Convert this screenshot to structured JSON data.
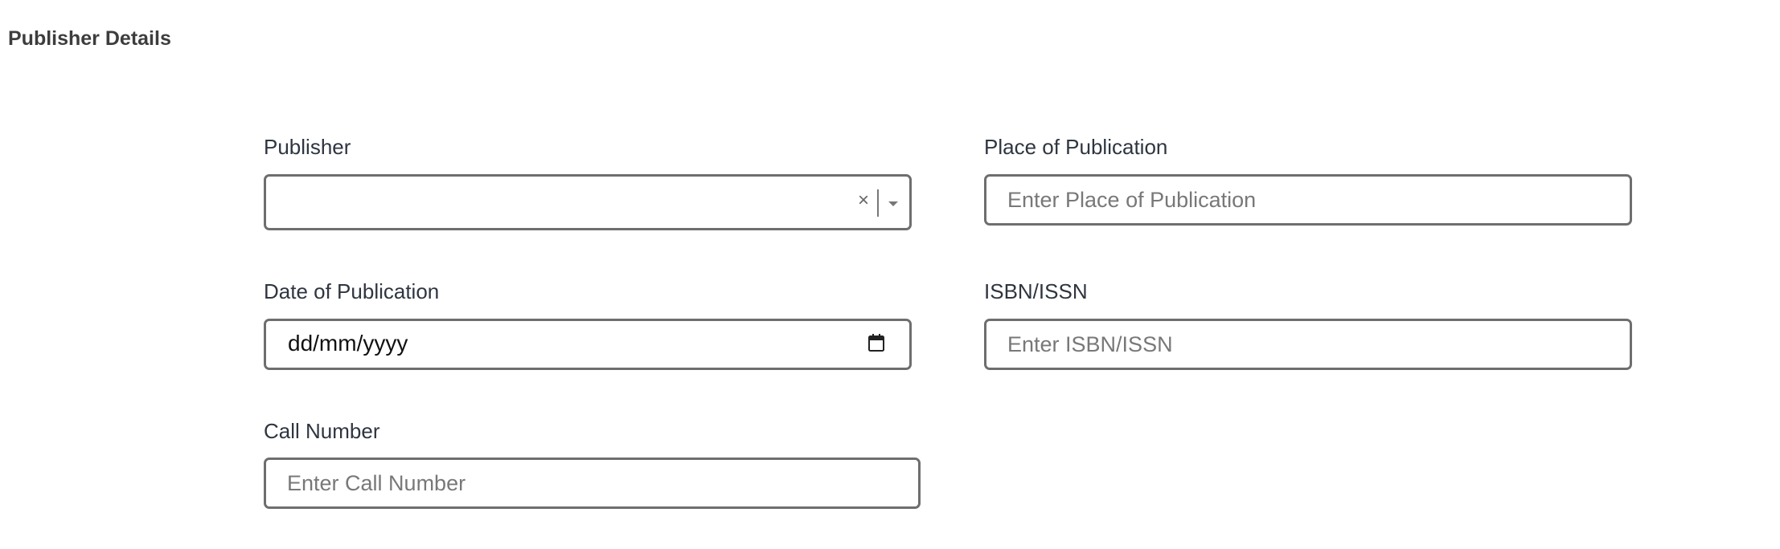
{
  "section": {
    "title": "Publisher Details"
  },
  "fields": {
    "publisher": {
      "label": "Publisher",
      "value": "",
      "clear_glyph": "×"
    },
    "place_of_publication": {
      "label": "Place of Publication",
      "placeholder": "Enter Place of Publication",
      "value": ""
    },
    "date_of_publication": {
      "label": "Date of Publication",
      "display": "dd/mm/yyyy",
      "icon": "calendar-icon"
    },
    "isbn_issn": {
      "label": "ISBN/ISSN",
      "placeholder": "Enter ISBN/ISSN",
      "value": ""
    },
    "call_number": {
      "label": "Call Number",
      "placeholder": "Enter Call Number",
      "value": ""
    }
  },
  "colors": {
    "border": "#6e6e6e",
    "label": "#2f3540",
    "placeholder": "#787878"
  }
}
